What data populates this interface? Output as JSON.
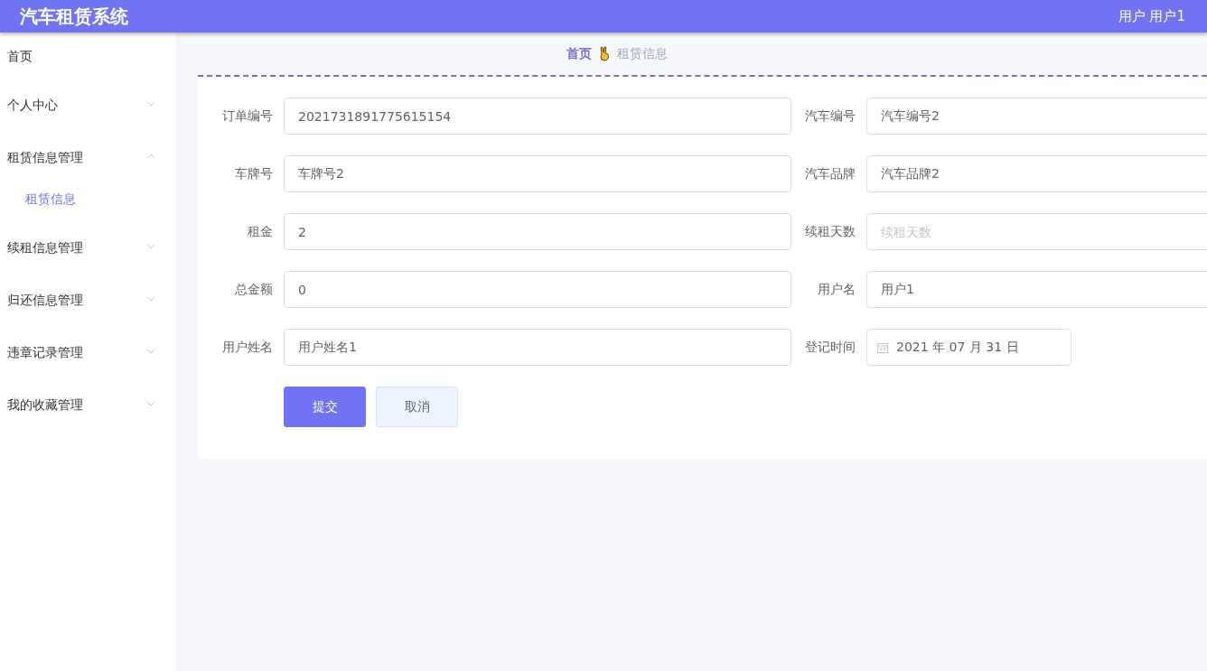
{
  "header": {
    "title": "汽车租赁系统",
    "user": "用户 用户1"
  },
  "sidebar": {
    "items": [
      {
        "label": "首页",
        "kind": "link",
        "selected": false
      },
      {
        "label": "个人中心",
        "kind": "menu",
        "expanded": false,
        "selected": false
      },
      {
        "label": "租赁信息管理",
        "kind": "menu",
        "expanded": true,
        "selected": false,
        "children": [
          {
            "label": "租赁信息",
            "selected": true
          }
        ]
      },
      {
        "label": "续租信息管理",
        "kind": "menu",
        "expanded": false,
        "selected": false
      },
      {
        "label": "归还信息管理",
        "kind": "menu",
        "expanded": false,
        "selected": false
      },
      {
        "label": "违章记录管理",
        "kind": "menu",
        "expanded": false,
        "selected": false
      },
      {
        "label": "我的收藏管理",
        "kind": "menu",
        "expanded": false,
        "selected": false
      }
    ]
  },
  "breadcrumb": [
    {
      "label": "首页"
    },
    {
      "label": "租赁信息"
    }
  ],
  "form": {
    "rows": [
      [
        {
          "label": "订单编号",
          "kind": "text",
          "value": "2021731891775615154"
        },
        {
          "label": "汽车编号",
          "kind": "text",
          "value": "汽车编号2"
        }
      ],
      [
        {
          "label": "车牌号",
          "kind": "text",
          "value": "车牌号2"
        },
        {
          "label": "汽车品牌",
          "kind": "text",
          "value": "汽车品牌2"
        }
      ],
      [
        {
          "label": "租金",
          "kind": "text",
          "value": "2"
        },
        {
          "label": "续租天数",
          "kind": "text",
          "placeholder": "续租天数"
        }
      ],
      [
        {
          "label": "总金额",
          "kind": "text",
          "value": "0"
        },
        {
          "label": "用户名",
          "kind": "text",
          "value": "用户1"
        }
      ],
      [
        {
          "label": "用户姓名",
          "kind": "text",
          "value": "用户姓名1"
        },
        {
          "label": "登记时间",
          "kind": "date",
          "value": "2021 年 07 月 31 日"
        }
      ]
    ],
    "buttons": [
      {
        "label": "提交",
        "kind": "primary"
      },
      {
        "label": "取消",
        "kind": "secondary"
      }
    ]
  }
}
